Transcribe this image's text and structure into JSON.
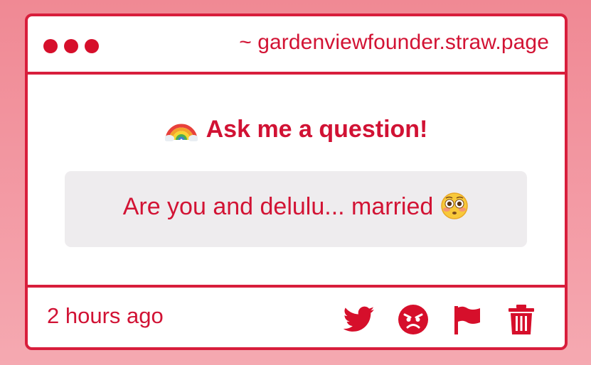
{
  "window": {
    "url": "~ gardenviewfounder.straw.page"
  },
  "prompt": {
    "icon": "rainbow-emoji",
    "title": "Ask me a question!"
  },
  "question": {
    "text": "Are you and delulu... married",
    "emoji": "flushed-face-emoji"
  },
  "footer": {
    "timestamp": "2 hours ago",
    "actions": [
      "twitter-icon",
      "angry-face-icon",
      "flag-icon",
      "trash-icon"
    ]
  },
  "colors": {
    "accent": "#d81e3c",
    "background_top": "#f08994",
    "background_bottom": "#f5a9b1",
    "question_box": "#eeecee"
  }
}
